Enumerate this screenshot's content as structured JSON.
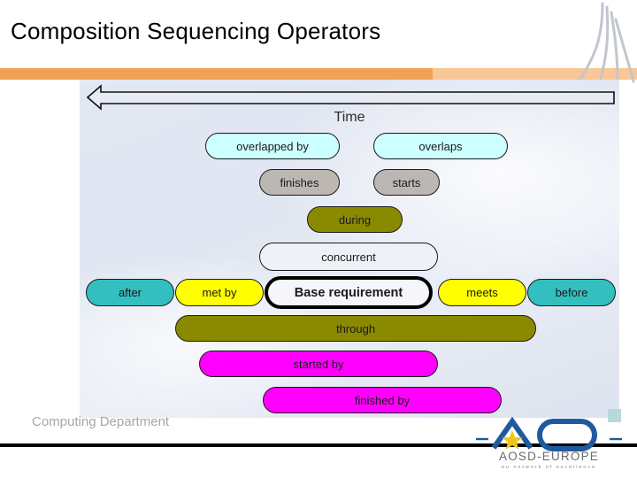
{
  "slide": {
    "title": "Composition Sequencing Operators",
    "footer_text": "Computing Department"
  },
  "colors": {
    "band_left": "#f2a057",
    "band_right": "#f9c795",
    "cyan": "#ccffff",
    "gray": "#bdb7b4",
    "olive": "#8a8a00",
    "teal": "#33bfbf",
    "yellow": "#ffff00",
    "magenta": "#ff00ff",
    "base_border": "#000000",
    "logo_blue": "#1f5a9e",
    "logo_star": "#f0c419"
  },
  "diagram": {
    "axis_label": "Time",
    "axis_direction": "left",
    "nodes": [
      {
        "label": "overlapped by",
        "color": "cyan"
      },
      {
        "label": "overlaps",
        "color": "cyan"
      },
      {
        "label": "finishes",
        "color": "gray"
      },
      {
        "label": "starts",
        "color": "gray"
      },
      {
        "label": "during",
        "color": "olive"
      },
      {
        "label": "concurrent",
        "color": "white"
      },
      {
        "label": "after",
        "color": "teal"
      },
      {
        "label": "met by",
        "color": "yellow"
      },
      {
        "label": "Base requirement",
        "color": "base"
      },
      {
        "label": "meets",
        "color": "yellow"
      },
      {
        "label": "before",
        "color": "teal"
      },
      {
        "label": "through",
        "color": "olive"
      },
      {
        "label": "started by",
        "color": "magenta"
      },
      {
        "label": "finished by",
        "color": "magenta"
      }
    ]
  },
  "logo": {
    "name": "AOSD-EUROPE",
    "tagline": "eu network of excellence"
  }
}
